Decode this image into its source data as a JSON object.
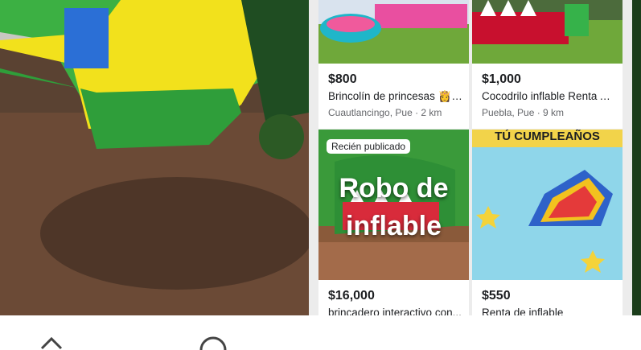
{
  "listings": [
    {
      "price": "$800",
      "title": "Brincolín de princesas 👸 ...",
      "location": "Cuautlancingo, Pue · 2 km"
    },
    {
      "price": "$1,000",
      "title": "Cocodrilo inflable Renta Al...",
      "location": "Puebla, Pue · 9 km"
    },
    {
      "price": "$16,000",
      "title": "brincadero interactivo con...",
      "badge": "Recién publicado",
      "image_text_1": "Robo de",
      "image_text_2": "inflable"
    },
    {
      "price": "$550",
      "title": "Renta de inflable",
      "image_heading": "TÚ CUMPLEAÑOS"
    }
  ],
  "colors": {
    "accent_green": "#39b54a",
    "grass": "#6fa83a",
    "caption_gray": "#65676b"
  },
  "icons": [
    "chevron-icon",
    "circle-icon"
  ]
}
